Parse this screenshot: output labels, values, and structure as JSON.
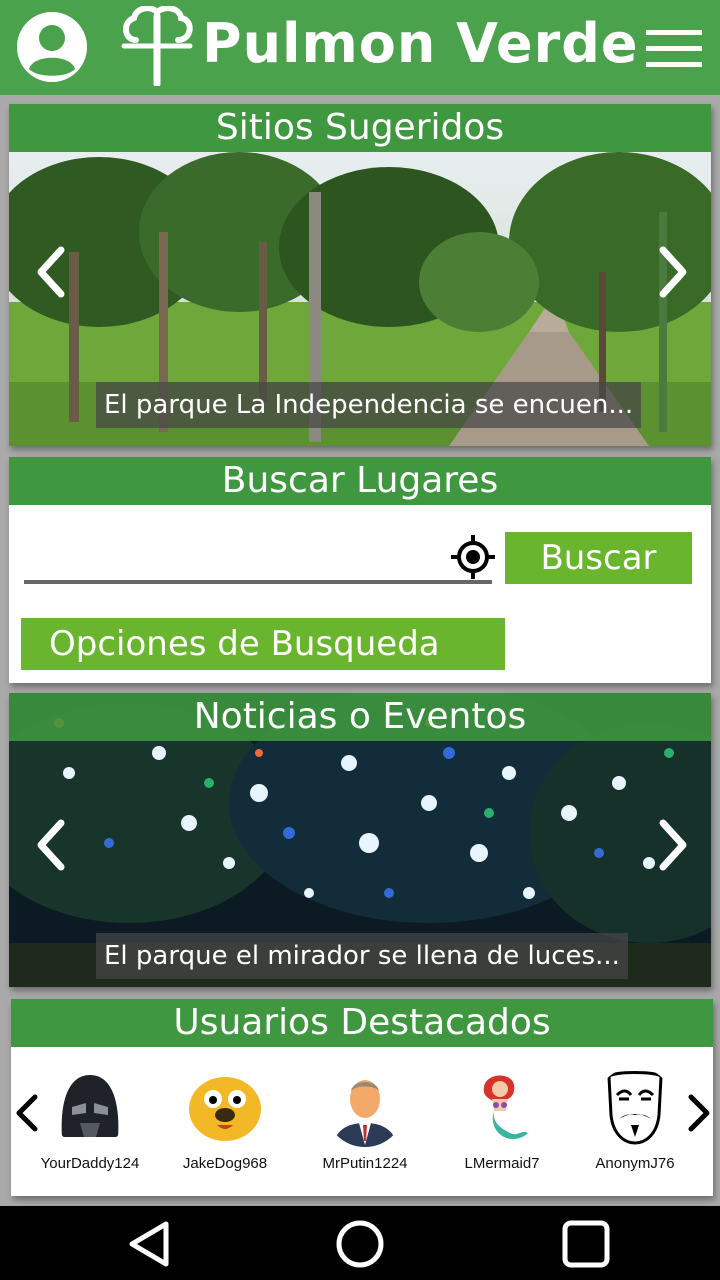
{
  "app": {
    "title": "Pulmon Verde",
    "brand_color": "#4ba24c",
    "header_color": "#3f983f",
    "button_color": "#6ab52e"
  },
  "icons": {
    "profile": "user-circle-icon",
    "logo": "tree-logo-icon",
    "menu": "hamburger-menu-icon",
    "prev": "chevron-left-icon",
    "next": "chevron-right-icon",
    "locate": "crosshair-location-icon",
    "nav_back": "triangle-back-icon",
    "nav_home": "circle-home-icon",
    "nav_recent": "square-recents-icon"
  },
  "suggested": {
    "title": "Sitios Sugeridos",
    "caption": "El parque La Independencia se encuen..."
  },
  "search": {
    "title": "Buscar Lugares",
    "input_value": "",
    "input_placeholder": "",
    "search_button": "Buscar",
    "options_button": "Opciones de Busqueda"
  },
  "news": {
    "title": "Noticias o Eventos",
    "caption": "El parque el mirador se llena de luces..."
  },
  "featured_users": {
    "title": "Usuarios Destacados",
    "users": [
      {
        "name": "YourDaddy124",
        "avatar": "darth-vader-avatar"
      },
      {
        "name": "JakeDog968",
        "avatar": "jake-dog-avatar"
      },
      {
        "name": "MrPutin1224",
        "avatar": "man-in-suit-avatar"
      },
      {
        "name": "LMermaid7",
        "avatar": "mermaid-avatar"
      },
      {
        "name": "AnonymJ76",
        "avatar": "guy-fawkes-mask-avatar"
      }
    ]
  }
}
